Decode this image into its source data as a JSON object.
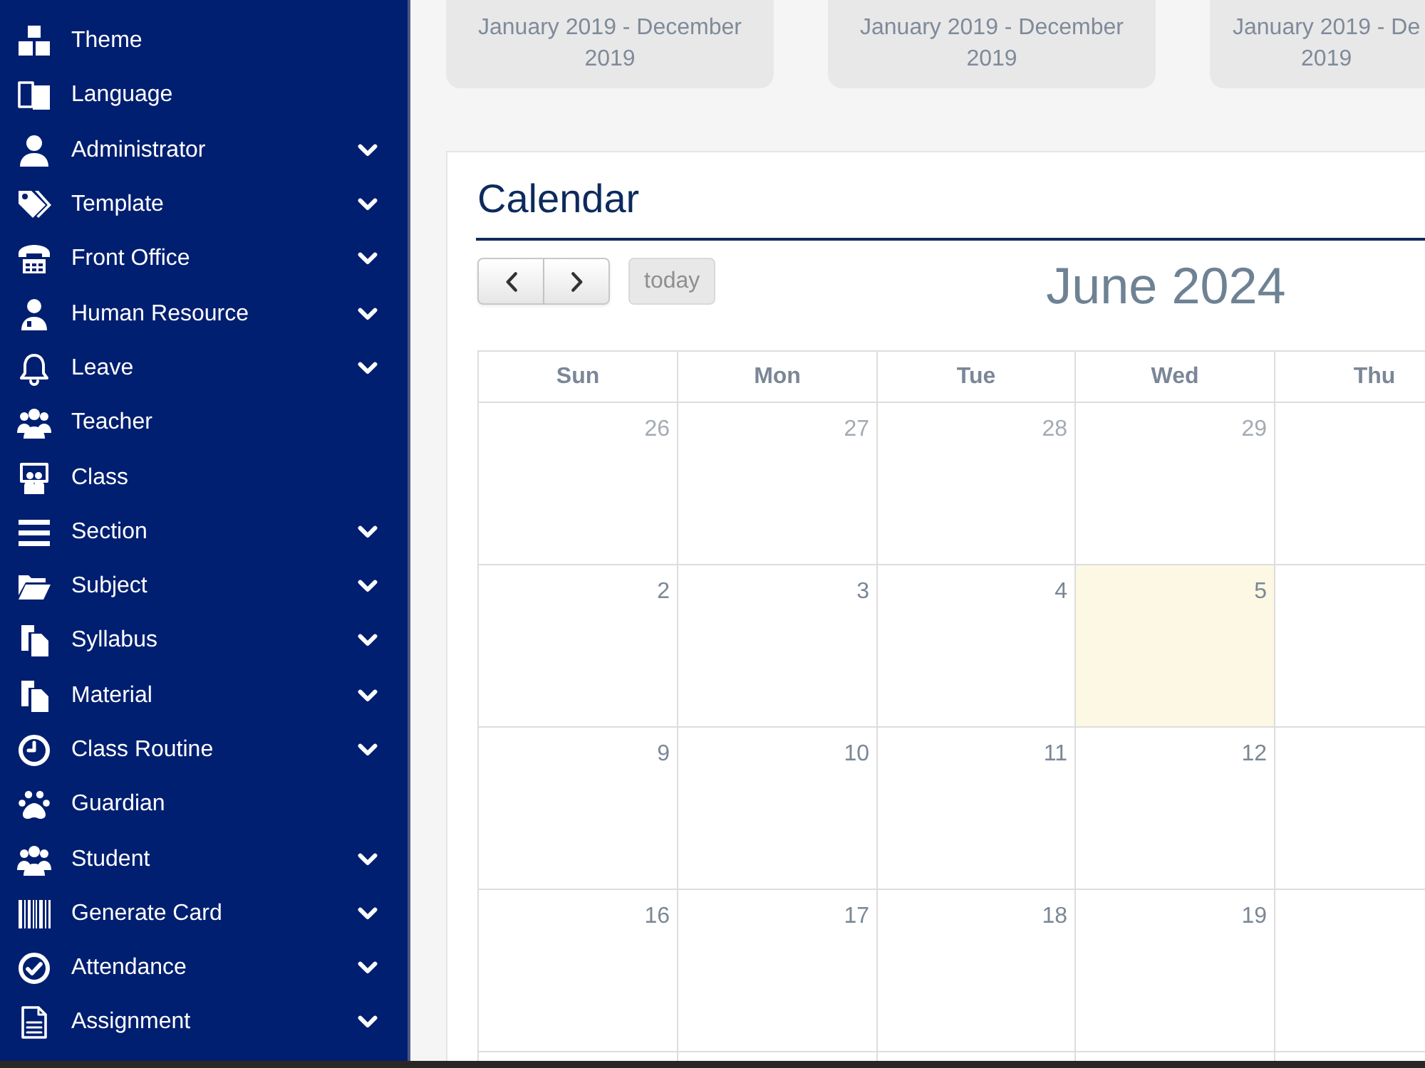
{
  "sidebar": {
    "items": [
      {
        "label": "Theme",
        "expandable": false
      },
      {
        "label": "Language",
        "expandable": false
      },
      {
        "label": "Administrator",
        "expandable": true
      },
      {
        "label": "Template",
        "expandable": true
      },
      {
        "label": "Front Office",
        "expandable": true
      },
      {
        "label": "Human Resource",
        "expandable": true
      },
      {
        "label": "Leave",
        "expandable": true
      },
      {
        "label": "Teacher",
        "expandable": false
      },
      {
        "label": "Class",
        "expandable": false
      },
      {
        "label": "Section",
        "expandable": true
      },
      {
        "label": "Subject",
        "expandable": true
      },
      {
        "label": "Syllabus",
        "expandable": true
      },
      {
        "label": "Material",
        "expandable": true
      },
      {
        "label": "Class Routine",
        "expandable": true
      },
      {
        "label": "Guardian",
        "expandable": false
      },
      {
        "label": "Student",
        "expandable": true
      },
      {
        "label": "Generate Card",
        "expandable": true
      },
      {
        "label": "Attendance",
        "expandable": true
      },
      {
        "label": "Assignment",
        "expandable": true
      }
    ]
  },
  "period_cards": [
    {
      "lines": [
        "January 2019 - December",
        "2019"
      ]
    },
    {
      "lines": [
        "January 2019 - December",
        "2019"
      ]
    },
    {
      "lines": [
        "January 2019 - De",
        "2019"
      ]
    }
  ],
  "calendar": {
    "title": "Calendar",
    "today_button": {
      "label": "today",
      "disabled": true
    },
    "month_title": "June 2024",
    "weekdays": [
      "Sun",
      "Mon",
      "Tue",
      "Wed",
      "Thu"
    ],
    "weeks": [
      {
        "days": [
          {
            "number": "26",
            "other_month": true,
            "today": false
          },
          {
            "number": "27",
            "other_month": true,
            "today": false
          },
          {
            "number": "28",
            "other_month": true,
            "today": false
          },
          {
            "number": "29",
            "other_month": true,
            "today": false
          }
        ]
      },
      {
        "days": [
          {
            "number": "2",
            "other_month": false,
            "today": false
          },
          {
            "number": "3",
            "other_month": false,
            "today": false
          },
          {
            "number": "4",
            "other_month": false,
            "today": false
          },
          {
            "number": "5",
            "other_month": false,
            "today": true
          }
        ]
      },
      {
        "days": [
          {
            "number": "9",
            "other_month": false,
            "today": false
          },
          {
            "number": "10",
            "other_month": false,
            "today": false
          },
          {
            "number": "11",
            "other_month": false,
            "today": false
          },
          {
            "number": "12",
            "other_month": false,
            "today": false
          }
        ]
      },
      {
        "days": [
          {
            "number": "16",
            "other_month": false,
            "today": false
          },
          {
            "number": "17",
            "other_month": false,
            "today": false
          },
          {
            "number": "18",
            "other_month": false,
            "today": false
          },
          {
            "number": "19",
            "other_month": false,
            "today": false
          }
        ]
      }
    ]
  }
}
